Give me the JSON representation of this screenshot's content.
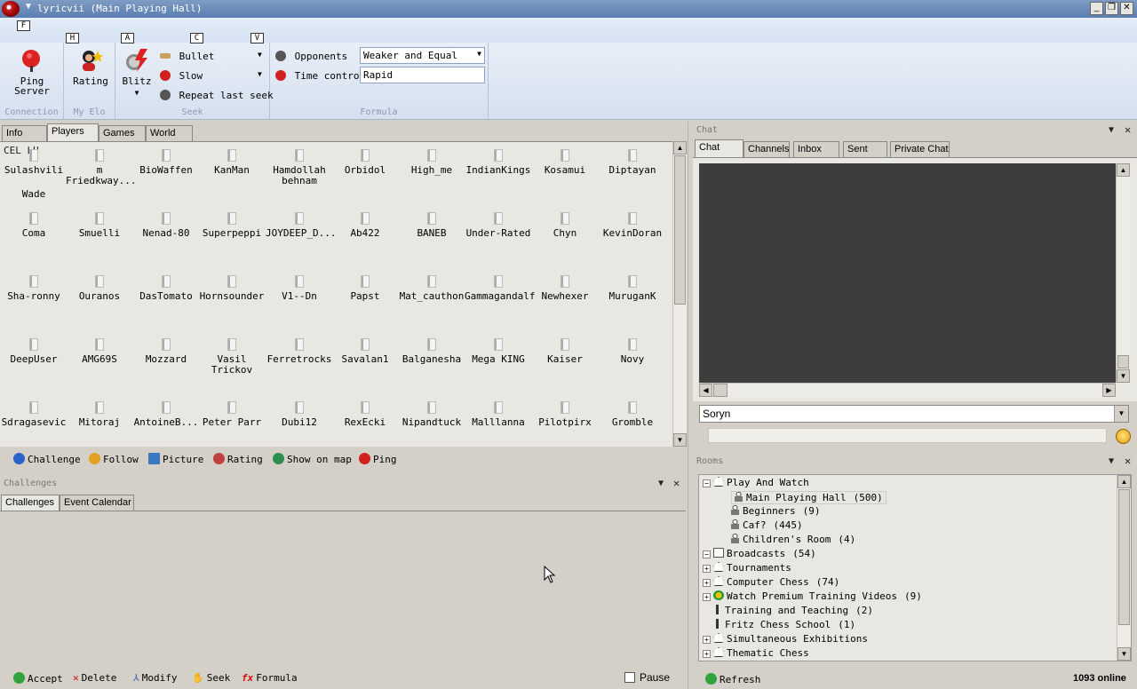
{
  "window": {
    "title": "lyricvii (Main Playing Hall)"
  },
  "keytips": {
    "f": "F",
    "h": "H",
    "a": "A",
    "c": "C",
    "v": "V"
  },
  "ribbon": {
    "connection": {
      "label": "Connection",
      "ping_server": "Ping Server"
    },
    "my_elo": {
      "label": "My Elo",
      "rating": "Rating"
    },
    "seek": {
      "label": "Seek",
      "blitz": "Blitz",
      "bullet": "Bullet",
      "slow": "Slow",
      "repeat_last_seek": "Repeat last seek"
    },
    "formula": {
      "label": "Formula",
      "opponents_label": "Opponents",
      "opponents_value": "Weaker and Equal",
      "time_control_label": "Time control",
      "time_control_value": "Rapid"
    }
  },
  "players_panel": {
    "tabs": [
      "Info",
      "Players",
      "Games",
      "World"
    ],
    "header_fragment": "CEL LU",
    "rows": [
      [
        "Sulashvili",
        "m Friedkway...",
        "BioWaffen",
        "KanMan",
        "Hamdollah behnam",
        "Orbidol",
        "High_me",
        "IndianKings",
        "Kosamui",
        "Diptayan"
      ],
      [
        "Wade"
      ],
      [
        "Coma",
        "Smuelli",
        "Nenad-80",
        "Superpeppi",
        "JOYDEEP_D...",
        "Ab422",
        "BANEB",
        "Under-Rated",
        "Chyn",
        "KevinDoran"
      ],
      [
        "Sha-ronny",
        "Ouranos",
        "DasTomato",
        "Hornsounder",
        "V1--Dn",
        "Papst",
        "Mat_cauthon",
        "Gammagandalf",
        "Newhexer",
        "MuruganK"
      ],
      [
        "DeepUser",
        "AMG69S",
        "Mozzard",
        "Vasil Trickov",
        "Ferretrocks",
        "Savalan1",
        "Balganesha",
        "Mega KING",
        "Kaiser",
        "Novy"
      ],
      [
        "Sdragasevic",
        "Mitoraj",
        "AntoineB...",
        "Peter Parr",
        "Dubi12",
        "RexEcki",
        "Nipandtuck",
        "Malllanna",
        "Pilotpirx",
        "Gromble"
      ]
    ],
    "toolbar": {
      "challenge": "Challenge",
      "follow": "Follow",
      "picture": "Picture",
      "rating": "Rating",
      "show_on_map": "Show on map",
      "ping": "Ping"
    }
  },
  "challenges_panel": {
    "title": "Challenges",
    "tabs": [
      "Challenges",
      "Event Calendar"
    ],
    "bottom": {
      "accept": "Accept",
      "delete": "Delete",
      "modify": "Modify",
      "seek": "Seek",
      "formula": "Formula",
      "pause": "Pause"
    }
  },
  "chat_panel": {
    "title": "Chat",
    "tabs": [
      "Chat",
      "Channels",
      "Inbox",
      "Sent",
      "Private Chat"
    ],
    "recipient": "Soryn",
    "message": ""
  },
  "rooms_panel": {
    "title": "Rooms",
    "rooms": [
      {
        "name": "Play And Watch",
        "count": ""
      },
      {
        "name": "Main Playing Hall",
        "count": "(500)"
      },
      {
        "name": "Beginners",
        "count": "(9)"
      },
      {
        "name": "Caf?",
        "count": "(445)"
      },
      {
        "name": "Children's Room",
        "count": "(4)"
      },
      {
        "name": "Broadcasts",
        "count": "(54)"
      },
      {
        "name": "Tournaments",
        "count": ""
      },
      {
        "name": "Computer Chess",
        "count": "(74)"
      },
      {
        "name": "Watch Premium Training Videos",
        "count": "(9)"
      },
      {
        "name": "Training and Teaching",
        "count": "(2)"
      },
      {
        "name": "Fritz Chess School",
        "count": "(1)"
      },
      {
        "name": "Simultaneous Exhibitions",
        "count": ""
      },
      {
        "name": "Thematic Chess",
        "count": ""
      }
    ],
    "refresh": "Refresh",
    "online": "1093 online"
  },
  "colors": {
    "accent": "#5b7eb0",
    "chat_bg": "#3d3d3d",
    "selected_room": "#e8e6e0"
  }
}
